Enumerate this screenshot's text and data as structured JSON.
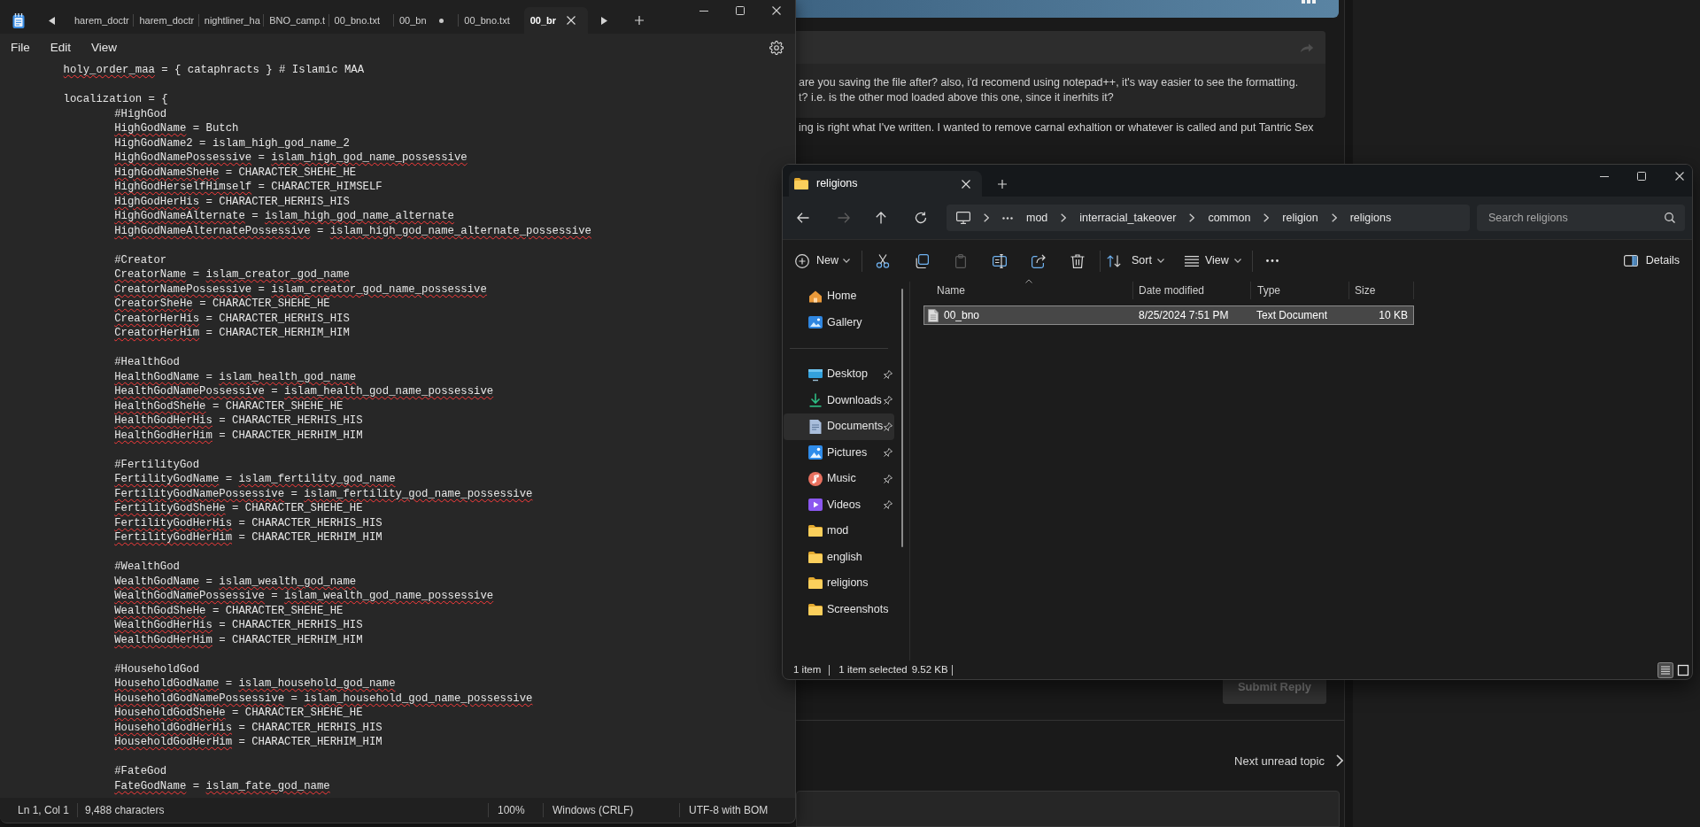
{
  "notepad": {
    "tabs": [
      {
        "label": "harem_doctr",
        "selected": false,
        "modified": false
      },
      {
        "label": "harem_doctr",
        "selected": false,
        "modified": false
      },
      {
        "label": "nightliner_ha",
        "selected": false,
        "modified": false
      },
      {
        "label": "BNO_camp.t",
        "selected": false,
        "modified": false
      },
      {
        "label": "00_bno.txt",
        "selected": false,
        "modified": false
      },
      {
        "label": "00_bn",
        "selected": false,
        "modified": true
      },
      {
        "label": "00_bno.txt",
        "selected": false,
        "modified": false
      },
      {
        "label": "00_br",
        "selected": true,
        "modified": false
      }
    ],
    "menu": [
      "File",
      "Edit",
      "View"
    ],
    "editor": {
      "blocks": [
        {
          "lines": [
            {
              "parts": [
                {
                  "text": "holy_order_maa",
                  "misspelled": true
                },
                {
                  "text": " = { cataphracts } # Islamic MAA",
                  "misspelled": false
                }
              ]
            }
          ]
        },
        {
          "lines": [
            {
              "parts": [
                {
                  "text": "localization = {",
                  "misspelled": false
                }
              ],
              "children": [
                {
                  "lines": [
                    {
                      "parts": [
                        {
                          "text": "#HighGod",
                          "misspelled": false
                        }
                      ]
                    },
                    {
                      "parts": [
                        {
                          "text": "HighGodName",
                          "misspelled": true
                        },
                        {
                          "text": " = Butch",
                          "misspelled": false
                        }
                      ]
                    },
                    {
                      "parts": [
                        {
                          "text": "HighGodName2 = islam_high_god_name_2",
                          "misspelled": false
                        }
                      ]
                    },
                    {
                      "parts": [
                        {
                          "text": "HighGodNamePossessive",
                          "misspelled": true
                        },
                        {
                          "text": " = ",
                          "misspelled": false
                        },
                        {
                          "text": "islam_high_god_name_possessive",
                          "misspelled": true
                        }
                      ]
                    },
                    {
                      "parts": [
                        {
                          "text": "HighGodNameSheHe",
                          "misspelled": true
                        },
                        {
                          "text": " = CHARACTER_SHEHE_HE",
                          "misspelled": false
                        }
                      ]
                    },
                    {
                      "parts": [
                        {
                          "text": "HighGodHerselfHimself",
                          "misspelled": true
                        },
                        {
                          "text": " = CHARACTER_HIMSELF",
                          "misspelled": false
                        }
                      ]
                    },
                    {
                      "parts": [
                        {
                          "text": "HighGodHerHis",
                          "misspelled": true
                        },
                        {
                          "text": " = CHARACTER_HERHIS_HIS",
                          "misspelled": false
                        }
                      ]
                    },
                    {
                      "parts": [
                        {
                          "text": "HighGodNameAlternate",
                          "misspelled": true
                        },
                        {
                          "text": " = ",
                          "misspelled": false
                        },
                        {
                          "text": "islam_high_god_name_alternate",
                          "misspelled": true
                        }
                      ]
                    },
                    {
                      "parts": [
                        {
                          "text": "HighGodNameAlternatePossessive",
                          "misspelled": true
                        },
                        {
                          "text": " = ",
                          "misspelled": false
                        },
                        {
                          "text": "islam_high_god_name_alternate_possessive",
                          "misspelled": true
                        }
                      ]
                    }
                  ]
                },
                {
                  "lines": [
                    {
                      "parts": [
                        {
                          "text": "#Creator",
                          "misspelled": false
                        }
                      ]
                    },
                    {
                      "parts": [
                        {
                          "text": "CreatorName",
                          "misspelled": true
                        },
                        {
                          "text": " = ",
                          "misspelled": false
                        },
                        {
                          "text": "islam_creator_god_name",
                          "misspelled": true
                        }
                      ]
                    },
                    {
                      "parts": [
                        {
                          "text": "CreatorNamePossessive",
                          "misspelled": true
                        },
                        {
                          "text": " = ",
                          "misspelled": false
                        },
                        {
                          "text": "islam_creator_god_name_possessive",
                          "misspelled": true
                        }
                      ]
                    },
                    {
                      "parts": [
                        {
                          "text": "CreatorSheHe",
                          "misspelled": true
                        },
                        {
                          "text": " = CHARACTER_SHEHE_HE",
                          "misspelled": false
                        }
                      ]
                    },
                    {
                      "parts": [
                        {
                          "text": "CreatorHerHis",
                          "misspelled": true
                        },
                        {
                          "text": " = CHARACTER_HERHIS_HIS",
                          "misspelled": false
                        }
                      ]
                    },
                    {
                      "parts": [
                        {
                          "text": "CreatorHerHim",
                          "misspelled": true
                        },
                        {
                          "text": " = CHARACTER_HERHIM_HIM",
                          "misspelled": false
                        }
                      ]
                    }
                  ]
                },
                {
                  "lines": [
                    {
                      "parts": [
                        {
                          "text": "#HealthGod",
                          "misspelled": false
                        }
                      ]
                    },
                    {
                      "parts": [
                        {
                          "text": "HealthGodName",
                          "misspelled": true
                        },
                        {
                          "text": " = ",
                          "misspelled": false
                        },
                        {
                          "text": "islam_health_god_name",
                          "misspelled": true
                        }
                      ]
                    },
                    {
                      "parts": [
                        {
                          "text": "HealthGodNamePossessive",
                          "misspelled": true
                        },
                        {
                          "text": " = ",
                          "misspelled": false
                        },
                        {
                          "text": "islam_health_god_name_possessive",
                          "misspelled": true
                        }
                      ]
                    },
                    {
                      "parts": [
                        {
                          "text": "HealthGodSheHe",
                          "misspelled": true
                        },
                        {
                          "text": " = CHARACTER_SHEHE_HE",
                          "misspelled": false
                        }
                      ]
                    },
                    {
                      "parts": [
                        {
                          "text": "HealthGodHerHis",
                          "misspelled": true
                        },
                        {
                          "text": " = CHARACTER_HERHIS_HIS",
                          "misspelled": false
                        }
                      ]
                    },
                    {
                      "parts": [
                        {
                          "text": "HealthGodHerHim",
                          "misspelled": true
                        },
                        {
                          "text": " = CHARACTER_HERHIM_HIM",
                          "misspelled": false
                        }
                      ]
                    }
                  ]
                },
                {
                  "lines": [
                    {
                      "parts": [
                        {
                          "text": "#FertilityGod",
                          "misspelled": false
                        }
                      ]
                    },
                    {
                      "parts": [
                        {
                          "text": "FertilityGodName",
                          "misspelled": true
                        },
                        {
                          "text": " = ",
                          "misspelled": false
                        },
                        {
                          "text": "islam_fertility_god_name",
                          "misspelled": true
                        }
                      ]
                    },
                    {
                      "parts": [
                        {
                          "text": "FertilityGodNamePossessive",
                          "misspelled": true
                        },
                        {
                          "text": " = ",
                          "misspelled": false
                        },
                        {
                          "text": "islam_fertility_god_name_possessive",
                          "misspelled": true
                        }
                      ]
                    },
                    {
                      "parts": [
                        {
                          "text": "FertilityGodSheHe",
                          "misspelled": true
                        },
                        {
                          "text": " = CHARACTER_SHEHE_HE",
                          "misspelled": false
                        }
                      ]
                    },
                    {
                      "parts": [
                        {
                          "text": "FertilityGodHerHis",
                          "misspelled": true
                        },
                        {
                          "text": " = CHARACTER_HERHIS_HIS",
                          "misspelled": false
                        }
                      ]
                    },
                    {
                      "parts": [
                        {
                          "text": "FertilityGodHerHim",
                          "misspelled": true
                        },
                        {
                          "text": " = CHARACTER_HERHIM_HIM",
                          "misspelled": false
                        }
                      ]
                    }
                  ]
                },
                {
                  "lines": [
                    {
                      "parts": [
                        {
                          "text": "#WealthGod",
                          "misspelled": false
                        }
                      ]
                    },
                    {
                      "parts": [
                        {
                          "text": "WealthGodName",
                          "misspelled": true
                        },
                        {
                          "text": " = ",
                          "misspelled": false
                        },
                        {
                          "text": "islam_wealth_god_name",
                          "misspelled": true
                        }
                      ]
                    },
                    {
                      "parts": [
                        {
                          "text": "WealthGodNamePossessive",
                          "misspelled": true
                        },
                        {
                          "text": " = ",
                          "misspelled": false
                        },
                        {
                          "text": "islam_wealth_god_name_possessive",
                          "misspelled": true
                        }
                      ]
                    },
                    {
                      "parts": [
                        {
                          "text": "WealthGodSheHe",
                          "misspelled": true
                        },
                        {
                          "text": " = CHARACTER_SHEHE_HE",
                          "misspelled": false
                        }
                      ]
                    },
                    {
                      "parts": [
                        {
                          "text": "WealthGodHerHis",
                          "misspelled": true
                        },
                        {
                          "text": " = CHARACTER_HERHIS_HIS",
                          "misspelled": false
                        }
                      ]
                    },
                    {
                      "parts": [
                        {
                          "text": "WealthGodHerHim",
                          "misspelled": true
                        },
                        {
                          "text": " = CHARACTER_HERHIM_HIM",
                          "misspelled": false
                        }
                      ]
                    }
                  ]
                },
                {
                  "lines": [
                    {
                      "parts": [
                        {
                          "text": "#HouseholdGod",
                          "misspelled": false
                        }
                      ]
                    },
                    {
                      "parts": [
                        {
                          "text": "HouseholdGodName",
                          "misspelled": true
                        },
                        {
                          "text": " = ",
                          "misspelled": false
                        },
                        {
                          "text": "islam_household_god_name",
                          "misspelled": true
                        }
                      ]
                    },
                    {
                      "parts": [
                        {
                          "text": "HouseholdGodNamePossessive",
                          "misspelled": true
                        },
                        {
                          "text": " = ",
                          "misspelled": false
                        },
                        {
                          "text": "islam_household_god_name_possessive",
                          "misspelled": true
                        }
                      ]
                    },
                    {
                      "parts": [
                        {
                          "text": "HouseholdGodSheHe",
                          "misspelled": true
                        },
                        {
                          "text": " = CHARACTER_SHEHE_HE",
                          "misspelled": false
                        }
                      ]
                    },
                    {
                      "parts": [
                        {
                          "text": "HouseholdGodHerHis",
                          "misspelled": true
                        },
                        {
                          "text": " = CHARACTER_HERHIS_HIS",
                          "misspelled": false
                        }
                      ]
                    },
                    {
                      "parts": [
                        {
                          "text": "HouseholdGodHerHim",
                          "misspelled": true
                        },
                        {
                          "text": " = CHARACTER_HERHIM_HIM",
                          "misspelled": false
                        }
                      ]
                    }
                  ]
                },
                {
                  "lines": [
                    {
                      "parts": [
                        {
                          "text": "#FateGod",
                          "misspelled": false
                        }
                      ]
                    },
                    {
                      "parts": [
                        {
                          "text": "FateGodName",
                          "misspelled": true
                        },
                        {
                          "text": " = ",
                          "misspelled": false
                        },
                        {
                          "text": "islam_fate_god_name",
                          "misspelled": true
                        }
                      ]
                    }
                  ]
                }
              ]
            }
          ]
        }
      ]
    },
    "status_bar": {
      "position": "Ln 1, Col 1",
      "characters": "9,488 characters",
      "zoom": "100%",
      "line_ending": "Windows (CRLF)",
      "encoding": "UTF-8 with BOM"
    }
  },
  "forum": {
    "quoted_post": {
      "lines": [
        "are you saving the file after? also, i'd recomend using notepad++, it's way easier to see the formatting.",
        "t? i.e. is the other mod loaded above this one, since it inerhits it?"
      ]
    },
    "reply_text": "ing is right what I've written. I wanted to remove carnal exhaltion or whatever is called and put Tantric Sex",
    "submit_button": {
      "label": "Submit Reply",
      "disabled": true
    },
    "next_topic": {
      "label": "Next unread topic"
    }
  },
  "explorer": {
    "tab": {
      "title": "religions"
    },
    "navigation": [
      {
        "kind": "back",
        "disabled": false
      },
      {
        "kind": "forward",
        "disabled": true
      },
      {
        "kind": "up",
        "disabled": false
      },
      {
        "kind": "refresh",
        "disabled": false
      }
    ],
    "address": [
      "mod",
      "interracial_takeover",
      "common",
      "religion",
      "religions"
    ],
    "search": {
      "placeholder": "Search religions"
    },
    "command_bar": {
      "new": "New",
      "tools": [
        {
          "kind": "cut",
          "disabled": false
        },
        {
          "kind": "copy",
          "disabled": false
        },
        {
          "kind": "paste",
          "disabled": true
        },
        {
          "kind": "rename",
          "disabled": false
        },
        {
          "kind": "share",
          "disabled": false
        },
        {
          "kind": "delete",
          "disabled": false
        }
      ],
      "sort": "Sort",
      "view": "View",
      "details": "Details"
    },
    "sidebar": {
      "groups": [
        {
          "items": [
            {
              "label": "Home",
              "kind": "home",
              "selected": false,
              "pinned": false
            },
            {
              "label": "Gallery",
              "kind": "gallery",
              "selected": false,
              "pinned": false
            }
          ]
        },
        {
          "items": [
            {
              "label": "Desktop",
              "kind": "desktop",
              "selected": false,
              "pinned": true
            },
            {
              "label": "Downloads",
              "kind": "downloads",
              "selected": false,
              "pinned": true
            },
            {
              "label": "Documents",
              "kind": "documents",
              "selected": true,
              "pinned": true
            },
            {
              "label": "Pictures",
              "kind": "pictures",
              "selected": false,
              "pinned": true
            },
            {
              "label": "Music",
              "kind": "music",
              "selected": false,
              "pinned": true
            },
            {
              "label": "Videos",
              "kind": "videos",
              "selected": false,
              "pinned": true
            },
            {
              "label": "mod",
              "kind": "folder",
              "selected": false,
              "pinned": false
            },
            {
              "label": "english",
              "kind": "folder",
              "selected": false,
              "pinned": false
            },
            {
              "label": "religions",
              "kind": "folder",
              "selected": false,
              "pinned": false
            },
            {
              "label": "Screenshots",
              "kind": "folder",
              "selected": false,
              "pinned": false
            }
          ]
        }
      ]
    },
    "file_list": {
      "columns": [
        {
          "label": "Name",
          "sorted": true
        },
        {
          "label": "Date modified",
          "sorted": false
        },
        {
          "label": "Type",
          "sorted": false
        },
        {
          "label": "Size",
          "sorted": false
        }
      ],
      "rows": [
        {
          "name": "00_bno",
          "date_modified": "8/25/2024 7:51 PM",
          "type": "Text Document",
          "size": "10 KB",
          "selected": true
        }
      ]
    },
    "status_bar": {
      "item_count": "1 item",
      "selection": "1 item selected",
      "selection_size": "9.52 KB",
      "view_modes": [
        {
          "kind": "details",
          "selected": true
        },
        {
          "kind": "tiles",
          "selected": false
        }
      ]
    }
  }
}
